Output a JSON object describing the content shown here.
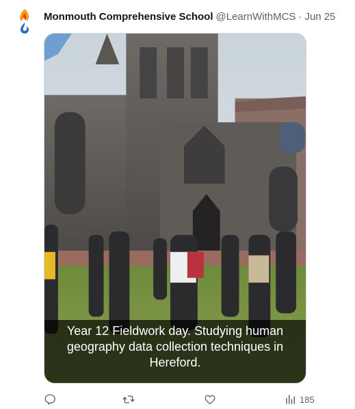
{
  "tweet": {
    "display_name": "Monmouth Comprehensive School",
    "handle": "@LearnWithMCS",
    "separator": "·",
    "date": "Jun 25",
    "caption": "Year 12 Fieldwork day. Studying human geography data collection techniques in Hereford.",
    "views": "185"
  },
  "icons": {
    "avatar": "school-flame-logo-icon",
    "reply": "reply-icon",
    "retweet": "retweet-icon",
    "like": "heart-icon",
    "views": "analytics-bar-icon"
  },
  "colors": {
    "text_primary": "#0f1419",
    "text_secondary": "#536471",
    "logo_flame": "#f0a30a",
    "logo_flame_inner": "#e0462a",
    "logo_drop": "#2a6fb8"
  }
}
